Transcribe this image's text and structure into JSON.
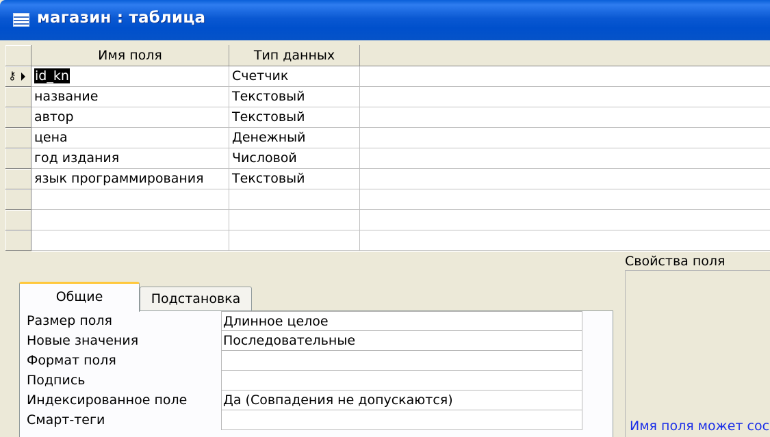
{
  "window": {
    "title": "магазин : таблица"
  },
  "grid": {
    "headers": {
      "field_name": "Имя поля",
      "data_type": "Тип данных",
      "description": ""
    },
    "rows": [
      {
        "name": "id_kn",
        "type": "Счетчик"
      },
      {
        "name": "название",
        "type": "Текстовый"
      },
      {
        "name": "автор",
        "type": "Текстовый"
      },
      {
        "name": "цена",
        "type": "Денежный"
      },
      {
        "name": "год издания",
        "type": "Числовой"
      },
      {
        "name": "язык программирования",
        "type": "Текстовый"
      },
      {
        "name": "",
        "type": ""
      },
      {
        "name": "",
        "type": ""
      },
      {
        "name": "",
        "type": ""
      }
    ],
    "primary_key_row_icon": "key-icon",
    "current_row_icon": "row-pointer-arrow-icon"
  },
  "properties": {
    "section_label": "Свойства поля",
    "tabs": {
      "general": "Общие",
      "lookup": "Подстановка"
    },
    "items": [
      {
        "label": "Размер поля",
        "value": "Длинное целое"
      },
      {
        "label": "Новые значения",
        "value": "Последовательные"
      },
      {
        "label": "Формат поля",
        "value": ""
      },
      {
        "label": "Подпись",
        "value": ""
      },
      {
        "label": "Индексированное поле",
        "value": "Да (Совпадения не допускаются)"
      },
      {
        "label": "Смарт-теги",
        "value": ""
      }
    ],
    "help_text": "Имя поля может сос"
  },
  "colors": {
    "titlebar": "#0a5fd8",
    "active_tab_accent": "#ffc83c",
    "help_text": "#1a2ee8"
  }
}
